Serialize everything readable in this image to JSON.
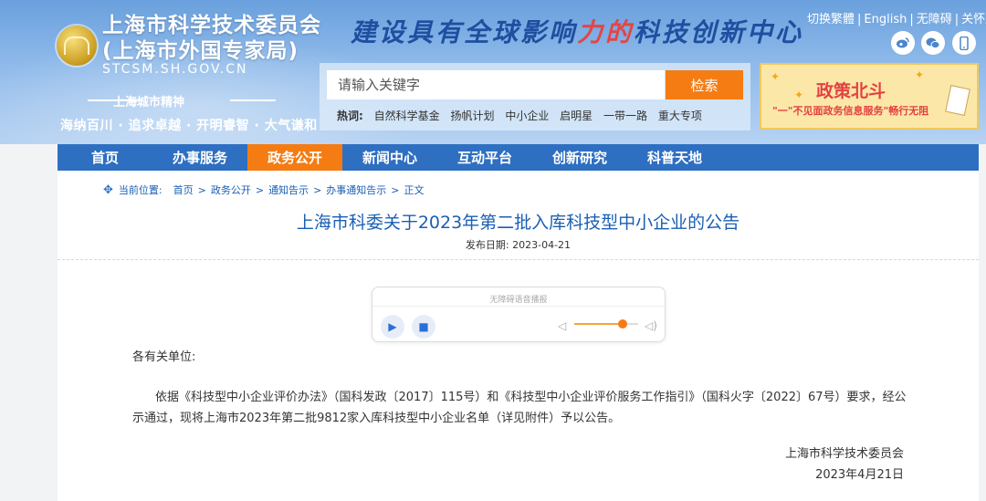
{
  "header": {
    "org_name": "上海市科学技术委员会",
    "org_sub": "(上海市外国专家局)",
    "domain": "STCSM.SH.GOV.CN",
    "slogan_a": "建设具有全球影响",
    "slogan_b": "力的",
    "slogan_c": "科技创新中心",
    "spirit_title": "上海城市精神",
    "spirit_text": "海纳百川 · 追求卓越 · 开明睿智 · 大气谦和",
    "top_links": [
      "切换繁體",
      "English",
      "无障碍",
      "关怀版"
    ],
    "social": [
      "weibo-icon",
      "wechat-icon",
      "mobile-icon"
    ]
  },
  "search": {
    "placeholder": "请输入关键字",
    "button": "检索",
    "hot_label": "热词:",
    "hot_words": [
      "自然科学基金",
      "扬帆计划",
      "中小企业",
      "启明星",
      "一带一路",
      "重大专项"
    ]
  },
  "banner": {
    "title": "政策北斗",
    "subtitle": "\"一\"不见面政务信息服务\"畅行无阻"
  },
  "nav": {
    "items": [
      "首页",
      "办事服务",
      "政务公开",
      "新闻中心",
      "互动平台",
      "创新研究",
      "科普天地"
    ],
    "active_index": 2
  },
  "breadcrumb": {
    "label": "当前位置:",
    "items": [
      "首页",
      "政务公开",
      "通知告示",
      "办事通知告示",
      "正文"
    ]
  },
  "article": {
    "title": "上海市科委关于2023年第二批入库科技型中小企业的公告",
    "date": "发布日期:  2023-04-21",
    "salutation": "各有关单位:",
    "para1_line1": "依据《科技型中小企业评价办法》（国科发政〔2017〕115号）和《科技型中小企业评价服务工作指引》（国科火字〔2022〕67号）要求，经公",
    "para1_line2": "示通过，现将上海市2023年第二批9812家入库科技型中小企业名单（详见附件）予以公告。",
    "signature": "上海市科学技术委员会",
    "sign_date": "2023年4月21日"
  },
  "player": {
    "label": "无障碍语音播报",
    "volume": 0.75
  },
  "colors": {
    "primary": "#2e6fc2",
    "accent": "#f57c13",
    "link": "#1a5fb4"
  }
}
